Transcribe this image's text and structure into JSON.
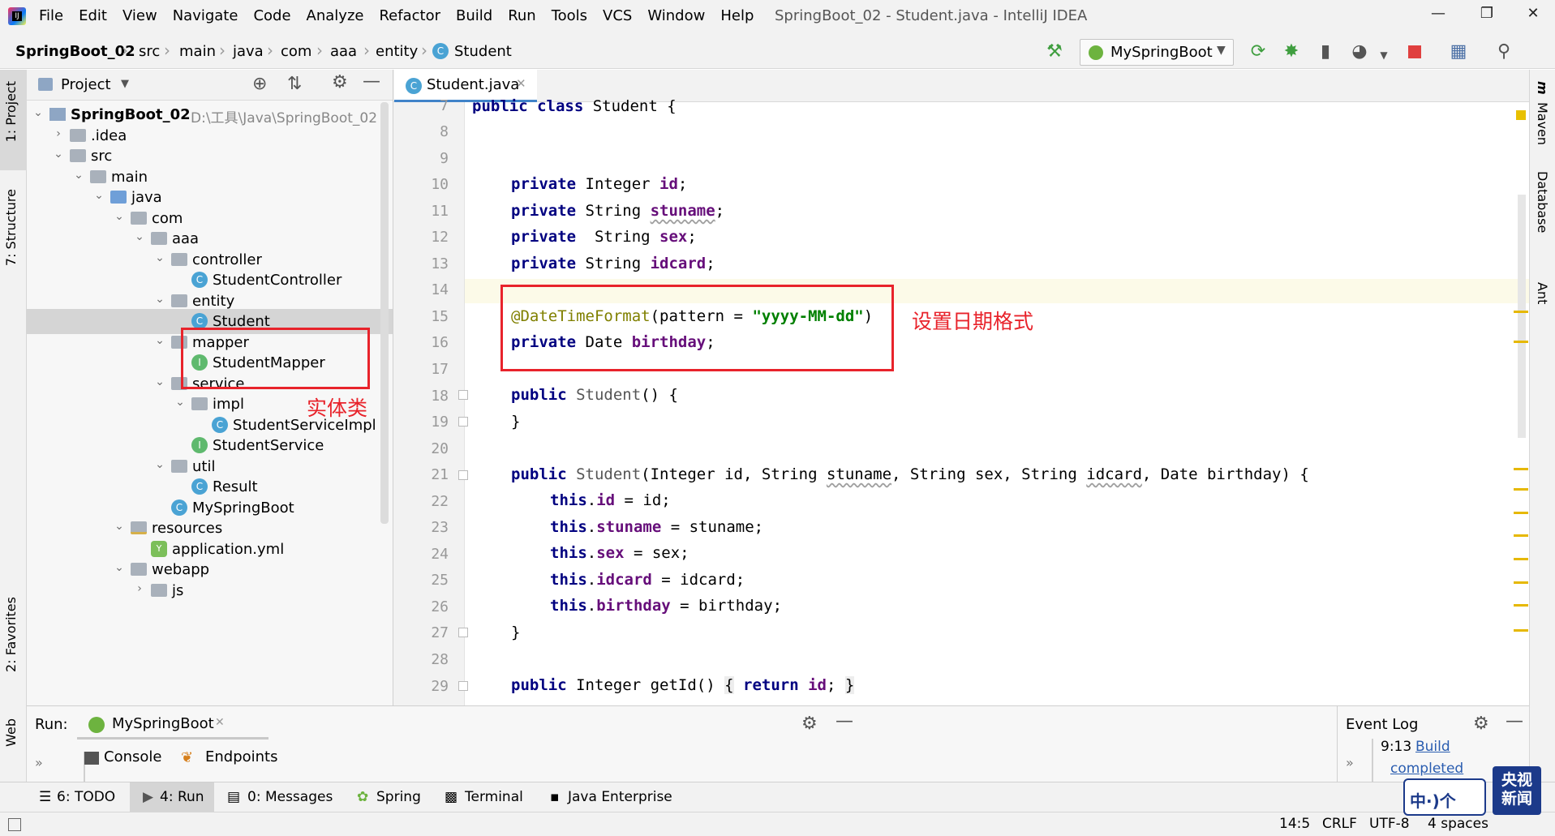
{
  "window": {
    "title": "SpringBoot_02 - Student.java - IntelliJ IDEA",
    "menu": [
      "File",
      "Edit",
      "View",
      "Navigate",
      "Code",
      "Analyze",
      "Refactor",
      "Build",
      "Run",
      "Tools",
      "VCS",
      "Window",
      "Help"
    ]
  },
  "breadcrumb": [
    "SpringBoot_02",
    "src",
    "main",
    "java",
    "com",
    "aaa",
    "entity",
    "Student"
  ],
  "run_config": "MySpringBoot",
  "left_tabs": [
    "1: Project",
    "7: Structure",
    "2: Favorites",
    "Web"
  ],
  "right_tabs": [
    "Maven",
    "Database",
    "Ant"
  ],
  "project_panel": {
    "title": "Project",
    "tree": [
      {
        "label": "SpringBoot_02",
        "path": "D:\\工具\\Java\\SpringBoot_02",
        "icon": "module",
        "expanded": true
      },
      {
        "label": ".idea",
        "icon": "folder",
        "expanded": false
      },
      {
        "label": "src",
        "icon": "folder",
        "expanded": true
      },
      {
        "label": "main",
        "icon": "folder",
        "expanded": true
      },
      {
        "label": "java",
        "icon": "folder-blue",
        "expanded": true
      },
      {
        "label": "com",
        "icon": "folder",
        "expanded": true
      },
      {
        "label": "aaa",
        "icon": "folder",
        "expanded": true
      },
      {
        "label": "controller",
        "icon": "folder",
        "expanded": true
      },
      {
        "label": "StudentController",
        "icon": "class"
      },
      {
        "label": "entity",
        "icon": "folder",
        "expanded": true
      },
      {
        "label": "Student",
        "icon": "class",
        "selected": true
      },
      {
        "label": "mapper",
        "icon": "folder",
        "expanded": true
      },
      {
        "label": "StudentMapper",
        "icon": "interface"
      },
      {
        "label": "service",
        "icon": "folder",
        "expanded": true
      },
      {
        "label": "impl",
        "icon": "folder",
        "expanded": true
      },
      {
        "label": "StudentServiceImpl",
        "icon": "class"
      },
      {
        "label": "StudentService",
        "icon": "interface"
      },
      {
        "label": "util",
        "icon": "folder",
        "expanded": true
      },
      {
        "label": "Result",
        "icon": "class"
      },
      {
        "label": "MySpringBoot",
        "icon": "class"
      },
      {
        "label": "resources",
        "icon": "folder-res",
        "expanded": true
      },
      {
        "label": "application.yml",
        "icon": "yml"
      },
      {
        "label": "webapp",
        "icon": "folder",
        "expanded": true
      },
      {
        "label": "js",
        "icon": "folder",
        "expanded": false
      }
    ]
  },
  "editor": {
    "tab": "Student.java",
    "lines": [
      7,
      8,
      9,
      10,
      11,
      12,
      13,
      14,
      15,
      16,
      17,
      18,
      19,
      20,
      21,
      22,
      23,
      24,
      25,
      26,
      27,
      28,
      29
    ]
  },
  "annotations": {
    "entity_note": "实体类",
    "date_note": "设置日期格式"
  },
  "run_panel": {
    "label": "Run:",
    "config_tab": "MySpringBoot",
    "tabs": [
      "Console",
      "Endpoints"
    ]
  },
  "event_log": {
    "title": "Event Log",
    "time": "9:13",
    "message_1": "Build",
    "message_2": "completed"
  },
  "tool_windows": [
    "6: TODO",
    "4: Run",
    "0: Messages",
    "Spring",
    "Terminal",
    "Java Enterprise"
  ],
  "status": {
    "position": "14:5",
    "line_sep": "CRLF",
    "encoding": "UTF-8",
    "indent": "4 spaces"
  },
  "watermark": {
    "left": "中·)个",
    "right": "央视新闻"
  }
}
